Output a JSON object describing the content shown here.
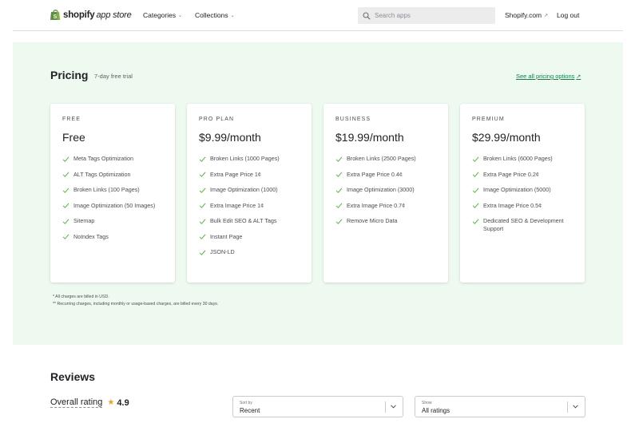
{
  "header": {
    "logo_brand": "shopify",
    "logo_sub": "app store",
    "nav": [
      {
        "label": "Categories"
      },
      {
        "label": "Collections"
      }
    ],
    "search_placeholder": "Search apps",
    "shopify_link": "Shopify.com",
    "logout": "Log out"
  },
  "pricing": {
    "title": "Pricing",
    "trial": "7-day free trial",
    "all_options": "See all pricing options",
    "plans": [
      {
        "name": "FREE",
        "price": "Free",
        "features": [
          "Meta Tags Optimization",
          "ALT Tags Optimization",
          "Broken Links (100 Pages)",
          "Image Optimization (50 Images)",
          "Sitemap",
          "NoIndex Tags"
        ]
      },
      {
        "name": "PRO PLAN",
        "price": "$9.99/month",
        "features": [
          "Broken Links (1000 Pages)",
          "Extra Page Price 1¢",
          "Image Optimization (1000)",
          "Extra Image Price 1¢",
          "Bulk Edit SEO & ALT Tags",
          "Instant Page",
          "JSON-LD"
        ]
      },
      {
        "name": "BUSINESS",
        "price": "$19.99/month",
        "features": [
          "Broken Links (2500 Pages)",
          "Extra Page Price 0.4¢",
          "Image Optimization (3000)",
          "Extra Image Price 0.7¢",
          "Remove Micro Data"
        ]
      },
      {
        "name": "PREMIUM",
        "price": "$29.99/month",
        "features": [
          "Broken Links (6000 Pages)",
          "Extra Page Price 0.2¢",
          "Image Optimization (5000)",
          "Extra Image Price 0.5¢",
          "Dedicated SEO & Development Support"
        ]
      }
    ],
    "footnotes": [
      "* All charges are billed in USD.",
      "** Recurring charges, including monthly or usage-based charges, are billed every 30 days."
    ]
  },
  "reviews": {
    "title": "Reviews",
    "overall_label": "Overall rating",
    "rating": "4.9",
    "sort": {
      "caption": "Sort by",
      "value": "Recent"
    },
    "show": {
      "caption": "Show",
      "value": "All ratings"
    }
  },
  "colors": {
    "accent_green": "#1b7a4a",
    "check_green": "#50b83c",
    "panel_bg": "#eefaf0",
    "star": "#e8a321"
  }
}
